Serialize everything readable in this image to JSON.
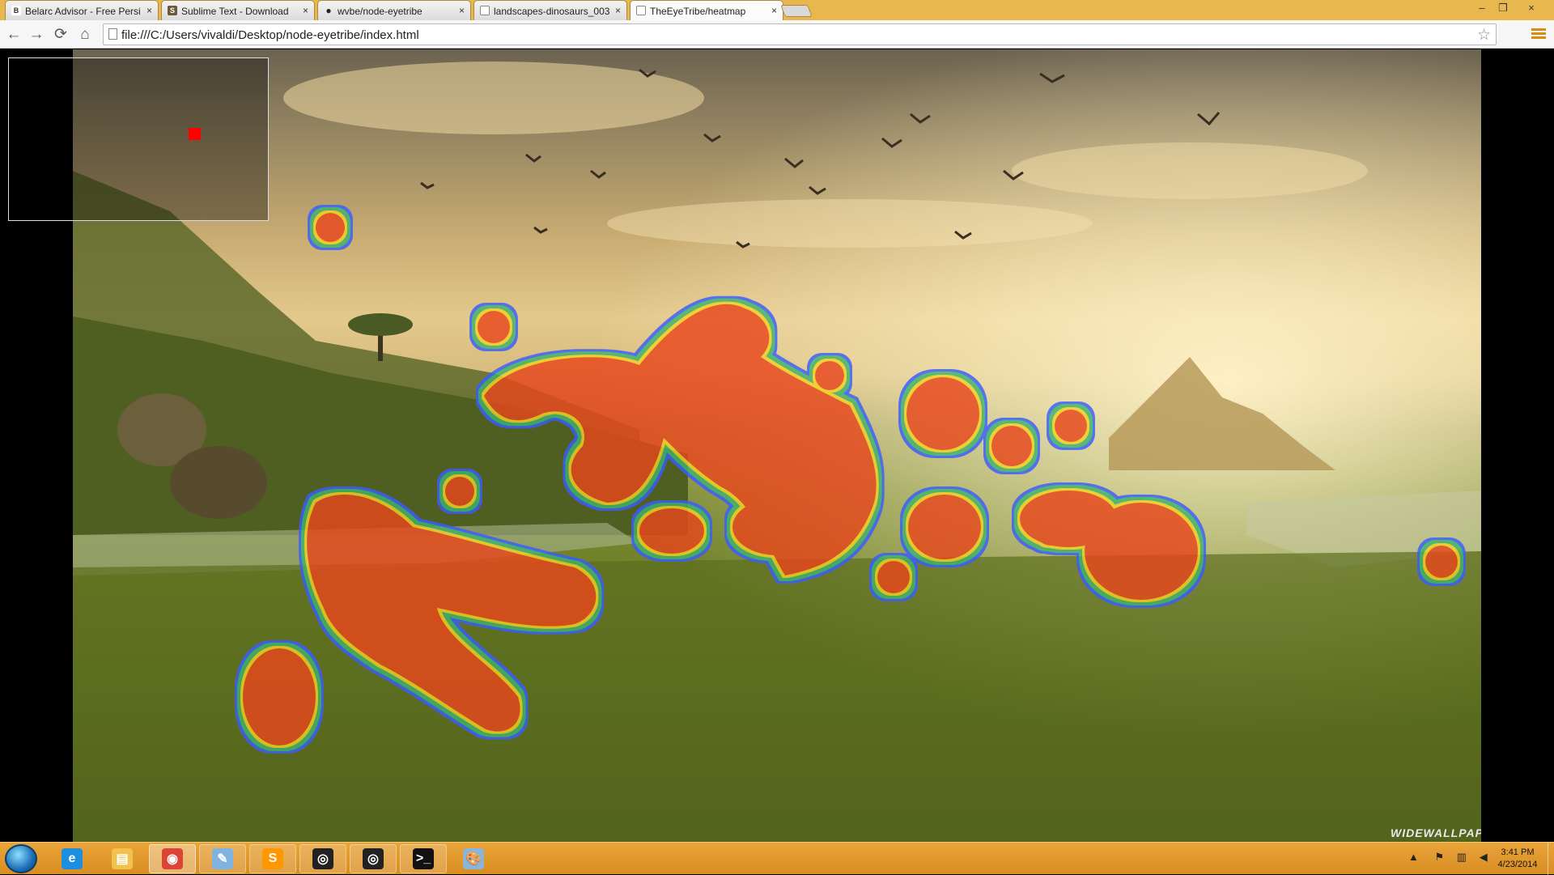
{
  "browser": {
    "tabs": [
      {
        "title": "Belarc Advisor - Free Persi",
        "icon": "belarc-icon",
        "icon_letter": "B"
      },
      {
        "title": "Sublime Text - Download",
        "icon": "sublime-icon",
        "icon_letter": "S"
      },
      {
        "title": "wvbe/node-eyetribe",
        "icon": "github-icon",
        "icon_letter": "●"
      },
      {
        "title": "landscapes-dinosaurs_003",
        "icon": "page-icon",
        "icon_letter": ""
      },
      {
        "title": "TheEyeTribe/heatmap",
        "icon": "page-icon",
        "icon_letter": ""
      }
    ],
    "active_tab": 4,
    "close_glyph": "×",
    "url": "file:///C:/Users/vivaldi/Desktop/node-eyetribe/index.html",
    "nav": {
      "back": "←",
      "forward": "→",
      "reload": "⟳",
      "home": "⌂",
      "star": "☆"
    },
    "window_controls": {
      "minimize": "–",
      "restore": "❐",
      "close": "×"
    }
  },
  "page": {
    "watermark": "WIDEWALLPAPERS.NET",
    "gaze_point_color": "#ff0000",
    "heatmap_colors": {
      "core": "#e8471f",
      "mid": "#f5d020",
      "edge": "#3ab56a",
      "halo": "#3a5cff"
    }
  },
  "taskbar": {
    "apps": [
      {
        "name": "internet-explorer-icon",
        "glyph": "e",
        "color": "#1d8fe0",
        "state": "pinned"
      },
      {
        "name": "file-explorer-icon",
        "glyph": "▤",
        "color": "#f2c14e",
        "state": "pinned"
      },
      {
        "name": "chrome-icon",
        "glyph": "◉",
        "color": "#db4437",
        "state": "active"
      },
      {
        "name": "notepad-icon",
        "glyph": "✎",
        "color": "#7fb3e0",
        "state": "running"
      },
      {
        "name": "sublime-text-icon",
        "glyph": "S",
        "color": "#ff9800",
        "state": "running"
      },
      {
        "name": "eyetribe-server-icon",
        "glyph": "◎",
        "color": "#222222",
        "state": "running"
      },
      {
        "name": "eyetribe-ui-icon",
        "glyph": "◎",
        "color": "#222222",
        "state": "running"
      },
      {
        "name": "command-prompt-icon",
        "glyph": ">_",
        "color": "#111111",
        "state": "running"
      },
      {
        "name": "paint-icon",
        "glyph": "🎨",
        "color": "#8ab4d8",
        "state": "pinned"
      }
    ],
    "tray": {
      "chevron": "▲",
      "flag": "⚑",
      "network": "▥",
      "volume": "◀"
    },
    "clock": {
      "time": "3:41 PM",
      "date": "4/23/2014"
    }
  }
}
